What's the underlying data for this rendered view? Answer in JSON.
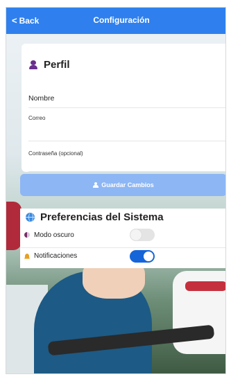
{
  "header": {
    "back_label": "Back",
    "back_icon": "chevron-left-icon",
    "title": "Configuración",
    "color": "#2f80ee"
  },
  "profile": {
    "section_title": "Perfil",
    "section_icon": "user-icon",
    "fields": {
      "name_label": "Nombre",
      "email_label": "Correo",
      "password_label": "Contraseña (opcional)"
    },
    "save_button": {
      "label": "Guardar Cambios",
      "icon": "user-icon",
      "color": "#8db6f4"
    }
  },
  "preferences": {
    "section_title": "Preferencias del Sistema",
    "section_icon": "globe-icon",
    "items": [
      {
        "label": "Modo oscuro",
        "icon": "moon-icon",
        "enabled": false
      },
      {
        "label": "Notificaciones",
        "icon": "bell-icon",
        "enabled": true
      }
    ],
    "toggle_on_color": "#1565d8"
  }
}
